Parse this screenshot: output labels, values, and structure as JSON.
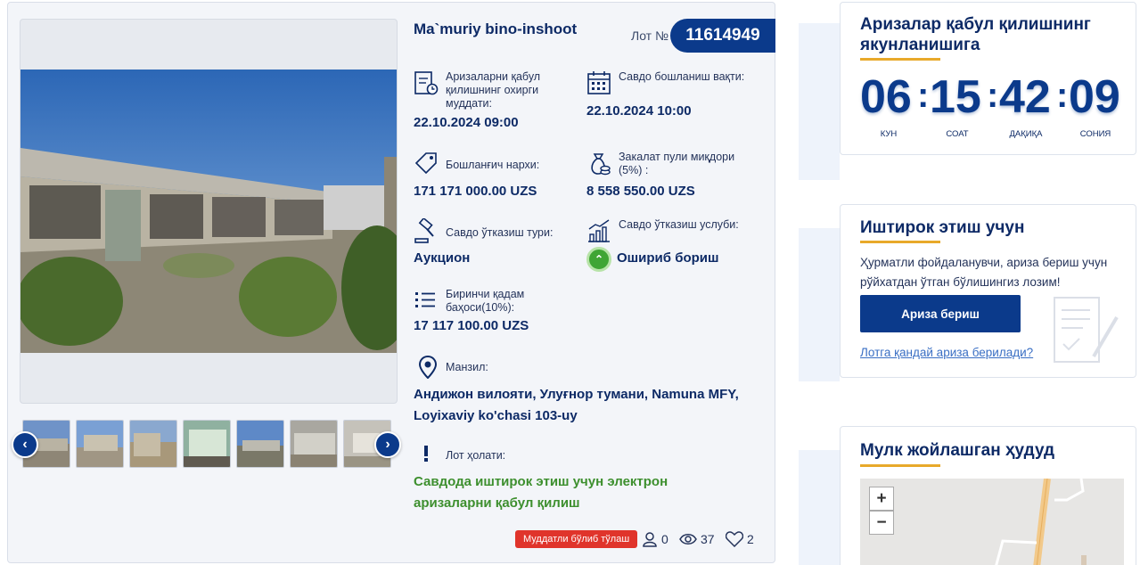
{
  "lot": {
    "title": "Ma`muriy bino-inshoot",
    "number_label": "Лот №",
    "number": "11614949",
    "thumbs_count": 7,
    "fields": {
      "deadline_label": "Аризаларни қабул қилишнинг охирги муддати:",
      "deadline_value": "22.10.2024 09:00",
      "start_label": "Савдо бошланиш вақти:",
      "start_value": "22.10.2024 10:00",
      "start_price_label": "Бошланғич нархи:",
      "start_price_value": "171 171 000.00 UZS",
      "deposit_label": "Закалат пули миқдори (5%) :",
      "deposit_value": "8 558 550.00 UZS",
      "type_label": "Савдо ўтказиш тури:",
      "type_value": "Аукцион",
      "method_label": "Савдо ўтказиш услуби:",
      "method_value": "Ошириб бориш",
      "first_step_label": "Биринчи қадам баҳоси(10%):",
      "first_step_value": "17 117 100.00 UZS"
    },
    "address_label": "Манзил:",
    "address_value": "Андижон вилояти, Улуғнор тумани, Namuna MFY, Loyixaviy ko'chasi 103-uy",
    "status_label": "Лот ҳолати:",
    "status_value": "Савдода иштирок этиш учун электрон аризаларни қабул қилиш",
    "installment_badge": "Муддатли бўлиб тўлаш",
    "participants": "0",
    "views": "37",
    "likes": "2"
  },
  "countdown": {
    "title": "Аризалар қабул қилишнинг якунланишига",
    "days": "06",
    "hours": "15",
    "minutes": "42",
    "seconds": "09",
    "days_label": "КУН",
    "hours_label": "СОАТ",
    "minutes_label": "ДАҚИҚА",
    "seconds_label": "СОНИЯ"
  },
  "participate": {
    "title": "Иштирок этиш учун",
    "text": "Ҳурматли фойдаланувчи, ариза бериш учун рўйхатдан ўтган бўлишингиз лозим!",
    "button": "Ариза бериш",
    "link": "Лотга қандай ариза берилади?"
  },
  "location": {
    "title": "Мулк жойлашган ҳудуд",
    "zoom_in": "+",
    "zoom_out": "−"
  },
  "colors": {
    "primary": "#0b3a8b",
    "accent": "#e8a92a",
    "status_green": "#3d8f2e",
    "badge_red": "#e0342b"
  }
}
